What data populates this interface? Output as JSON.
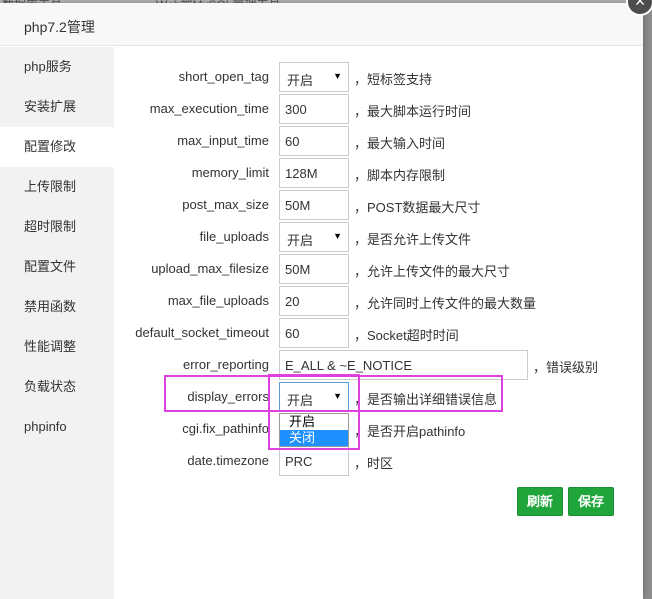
{
  "background": {
    "text_left": "数据库工具",
    "text_mid": "Web端MySQL管理工具"
  },
  "dialog": {
    "title": "php7.2管理",
    "close_glyph": "×"
  },
  "sidebar": {
    "items": [
      {
        "label": "php服务"
      },
      {
        "label": "安装扩展"
      },
      {
        "label": "配置修改"
      },
      {
        "label": "上传限制"
      },
      {
        "label": "超时限制"
      },
      {
        "label": "配置文件"
      },
      {
        "label": "禁用函数"
      },
      {
        "label": "性能调整"
      },
      {
        "label": "负载状态"
      },
      {
        "label": "phpinfo"
      }
    ],
    "active": "配置修改"
  },
  "form": {
    "rows": [
      {
        "label": "short_open_tag",
        "type": "select",
        "value": "开启",
        "desc": "，短标签支持"
      },
      {
        "label": "max_execution_time",
        "type": "input",
        "value": "300",
        "desc": "，最大脚本运行时间"
      },
      {
        "label": "max_input_time",
        "type": "input",
        "value": "60",
        "desc": "，最大输入时间"
      },
      {
        "label": "memory_limit",
        "type": "input",
        "value": "128M",
        "desc": "，脚本内存限制"
      },
      {
        "label": "post_max_size",
        "type": "input",
        "value": "50M",
        "desc": "，POST数据最大尺寸"
      },
      {
        "label": "file_uploads",
        "type": "select",
        "value": "开启",
        "desc": "，是否允许上传文件"
      },
      {
        "label": "upload_max_filesize",
        "type": "input",
        "value": "50M",
        "desc": "，允许上传文件的最大尺寸"
      },
      {
        "label": "max_file_uploads",
        "type": "input",
        "value": "20",
        "desc": "，允许同时上传文件的最大数量"
      },
      {
        "label": "default_socket_timeout",
        "type": "input",
        "value": "60",
        "desc": "，Socket超时时间"
      },
      {
        "label": "error_reporting",
        "type": "input-wide",
        "value": "E_ALL & ~E_NOTICE",
        "desc": "，错误级别"
      },
      {
        "label": "display_errors",
        "type": "select",
        "value": "开启",
        "desc": "，是否输出详细错误信息"
      },
      {
        "label": "cgi.fix_pathinfo",
        "type": "select",
        "value": "开启",
        "desc": "，是否开启pathinfo"
      },
      {
        "label": "date.timezone",
        "type": "input",
        "value": "PRC",
        "desc": "，时区"
      }
    ],
    "dropdown_options": [
      "开启",
      "关闭"
    ],
    "dropdown_highlighted": "关闭"
  },
  "buttons": {
    "refresh": "刷新",
    "save": "保存"
  },
  "colors": {
    "accent": "#20a53a",
    "highlight": "#e040e0",
    "selected_option": "#1e90ff"
  }
}
